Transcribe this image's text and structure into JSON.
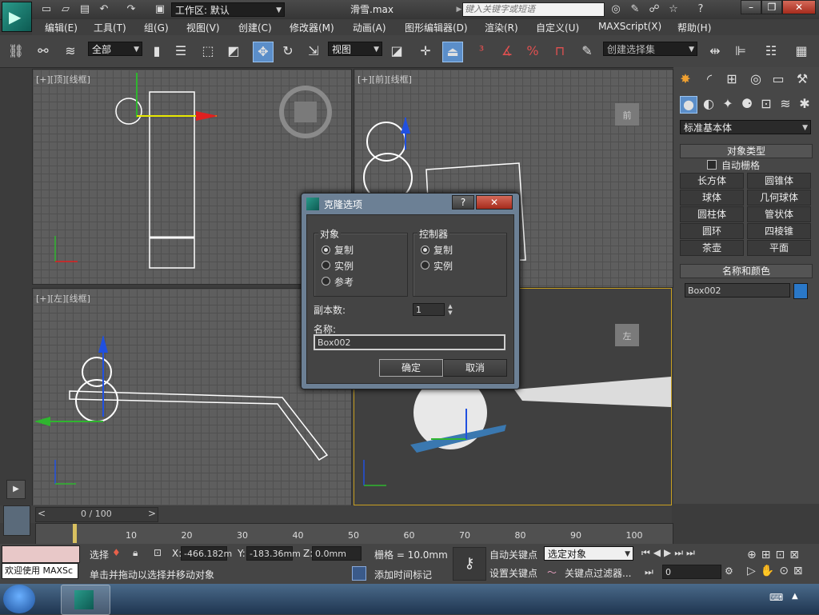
{
  "title_bar": {
    "workspace_label": "工作区: 默认",
    "file_title": "滑雪.max",
    "search_placeholder": "键入关键字或短语"
  },
  "menu": [
    "编辑(E)",
    "工具(T)",
    "组(G)",
    "视图(V)",
    "创建(C)",
    "修改器(M)",
    "动画(A)",
    "图形编辑器(D)",
    "渲染(R)",
    "自定义(U)",
    "MAXScript(X)",
    "帮助(H)"
  ],
  "toolbar": {
    "filter_value": "全部",
    "refcoord_value": "视图",
    "named_selection_placeholder": "创建选择集"
  },
  "viewports": {
    "top": {
      "label": "[+][顶][线框]"
    },
    "front": {
      "label": "[+][前][线框]",
      "cube_label": "前"
    },
    "left": {
      "label": "[+][左][线框]"
    },
    "persp": {
      "cube_label": "左"
    }
  },
  "command_panel": {
    "category_value": "标准基本体",
    "object_type_title": "对象类型",
    "auto_grid": "自动栅格",
    "buttons": [
      "长方体",
      "圆锥体",
      "球体",
      "几何球体",
      "圆柱体",
      "管状体",
      "圆环",
      "四棱锥",
      "茶壶",
      "平面"
    ],
    "name_color_title": "名称和颜色",
    "object_name": "Box002",
    "object_color": "#2a78c8"
  },
  "dialog": {
    "title": "克隆选项",
    "object_group": "对象",
    "object_options": [
      "复制",
      "实例",
      "参考"
    ],
    "object_selected": 0,
    "controller_group": "控制器",
    "controller_options": [
      "复制",
      "实例"
    ],
    "controller_selected": 0,
    "copies_label": "副本数:",
    "copies_value": "1",
    "name_label": "名称:",
    "name_value": "Box002",
    "ok": "确定",
    "cancel": "取消"
  },
  "timeline": {
    "frame_display": "0 / 100",
    "ticks": [
      "10",
      "20",
      "30",
      "40",
      "50",
      "60",
      "70",
      "80",
      "90",
      "100"
    ]
  },
  "status": {
    "maxscript_label": "欢迎使用 MAXSc",
    "select_label": "选择",
    "x_label": "X:",
    "x_value": "-466.182m",
    "y_label": "Y:",
    "y_value": "-183.36mm",
    "z_label": "Z:",
    "z_value": "0.0mm",
    "grid_text": "栅格 = 10.0mm",
    "prompt": "单击并拖动以选择并移动对象",
    "add_time_tag": "添加时间标记",
    "auto_key": "自动关键点",
    "set_key": "设置关键点",
    "key_mode_value": "选定对象",
    "key_filters": "关键点过滤器...",
    "current_frame": "0"
  }
}
